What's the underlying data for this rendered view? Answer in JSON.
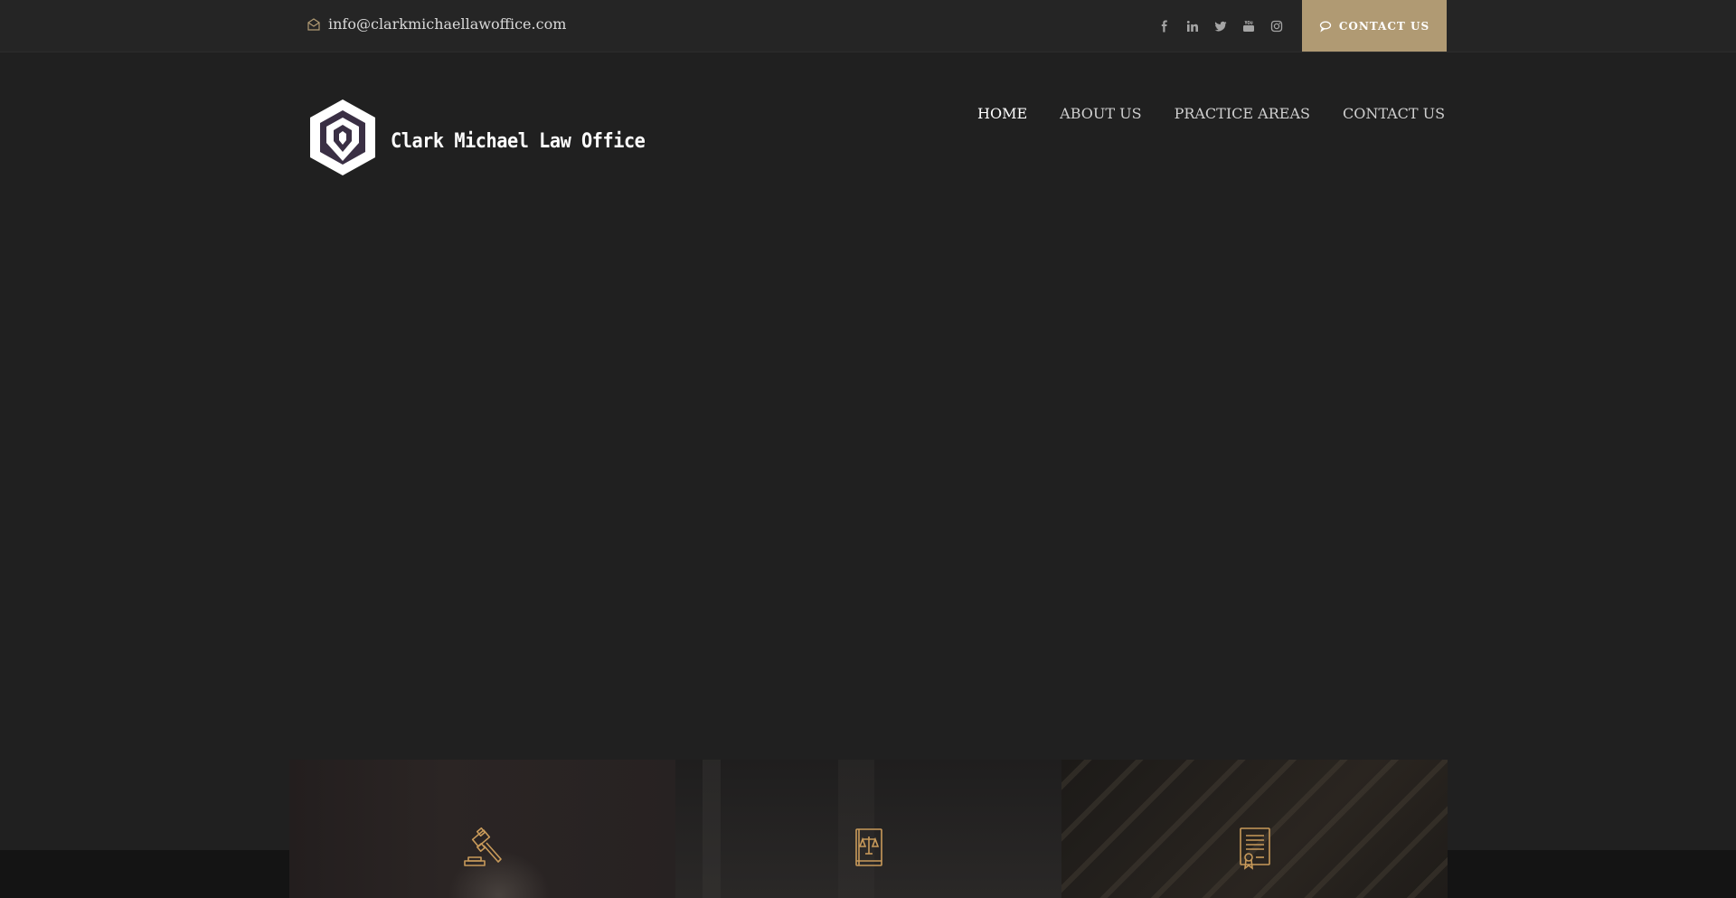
{
  "topbar": {
    "email": "info@clarkmichaellawoffice.com",
    "social_icons": [
      "facebook-icon",
      "linkedin-icon",
      "twitter-icon",
      "youtube-icon",
      "instagram-icon"
    ],
    "contact_button": "CONTACT US"
  },
  "header": {
    "brand": "Clark Michael Law Office",
    "nav": [
      "HOME",
      "ABOUT US",
      "PRACTICE AREAS",
      "CONTACT US"
    ]
  },
  "feature_cards": [
    {
      "icon": "gavel-icon"
    },
    {
      "icon": "law-book-icon"
    },
    {
      "icon": "certificate-icon"
    }
  ],
  "colors": {
    "accent": "#b09a73",
    "icon_accent": "#c89a5a",
    "background": "#202020",
    "topbar": "#252525"
  }
}
